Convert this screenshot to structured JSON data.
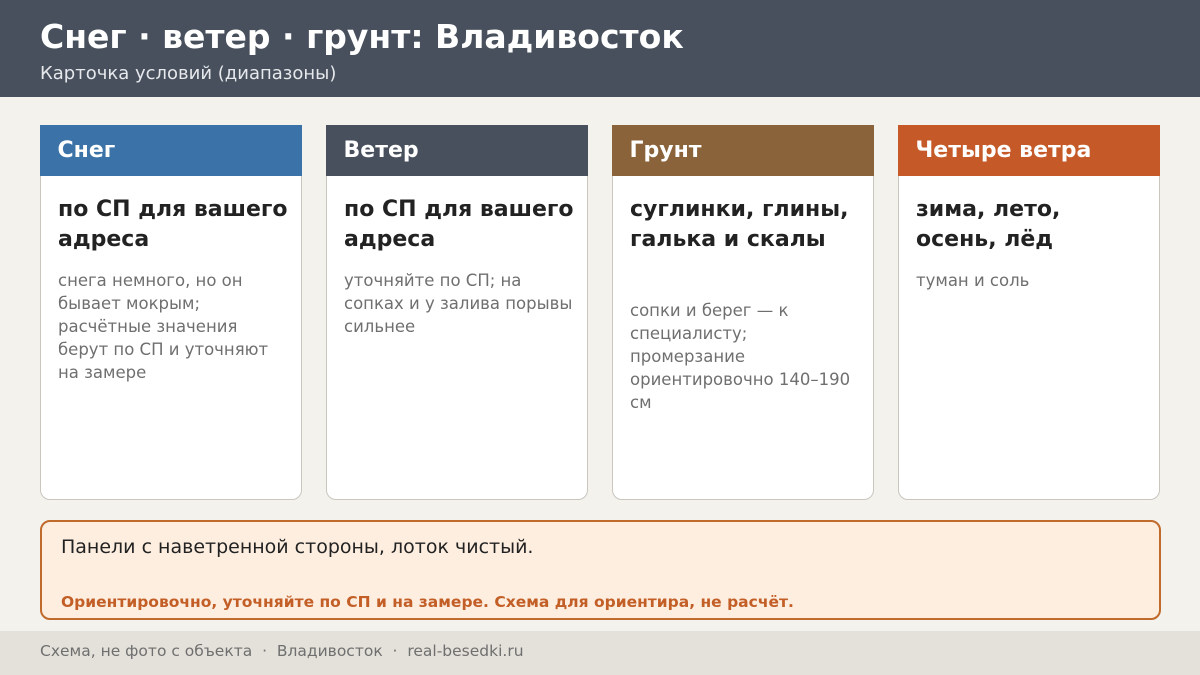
{
  "header": {
    "title": "Снег · ветер · грунт: Владивосток",
    "subtitle": "Карточка условий (диапазоны)"
  },
  "cards": [
    {
      "label": "Снег",
      "value": "по СП для вашего адреса",
      "note": "снега немного, но он бывает мокрым; расчётные значения берут по СП и уточняют на замере",
      "color": "#3b73a8"
    },
    {
      "label": "Ветер",
      "value": "по СП для вашего адреса",
      "note": "уточняйте по СП; на сопках и у залива порывы сильнее",
      "color": "#47505c"
    },
    {
      "label": "Грунт",
      "value": "суглинки, глины, галька и скалы",
      "note": "сопки и берег — к специалисту; промерзание ориентировочно 140–190 см",
      "color": "#8b633a"
    },
    {
      "label": "Четыре ветра",
      "value": "зима, лето, осень, лёд",
      "note": "туман и соль",
      "color": "#c55a28"
    }
  ],
  "note": {
    "text": "Панели с наветренной стороны, лоток чистый.",
    "warning": "Ориентировочно, уточняйте по СП и на замере. Схема для ориентира, не расчёт."
  },
  "footer": {
    "text": "Схема, не фото с объекта  ·  Владивосток  ·  real-besedki.ru"
  }
}
